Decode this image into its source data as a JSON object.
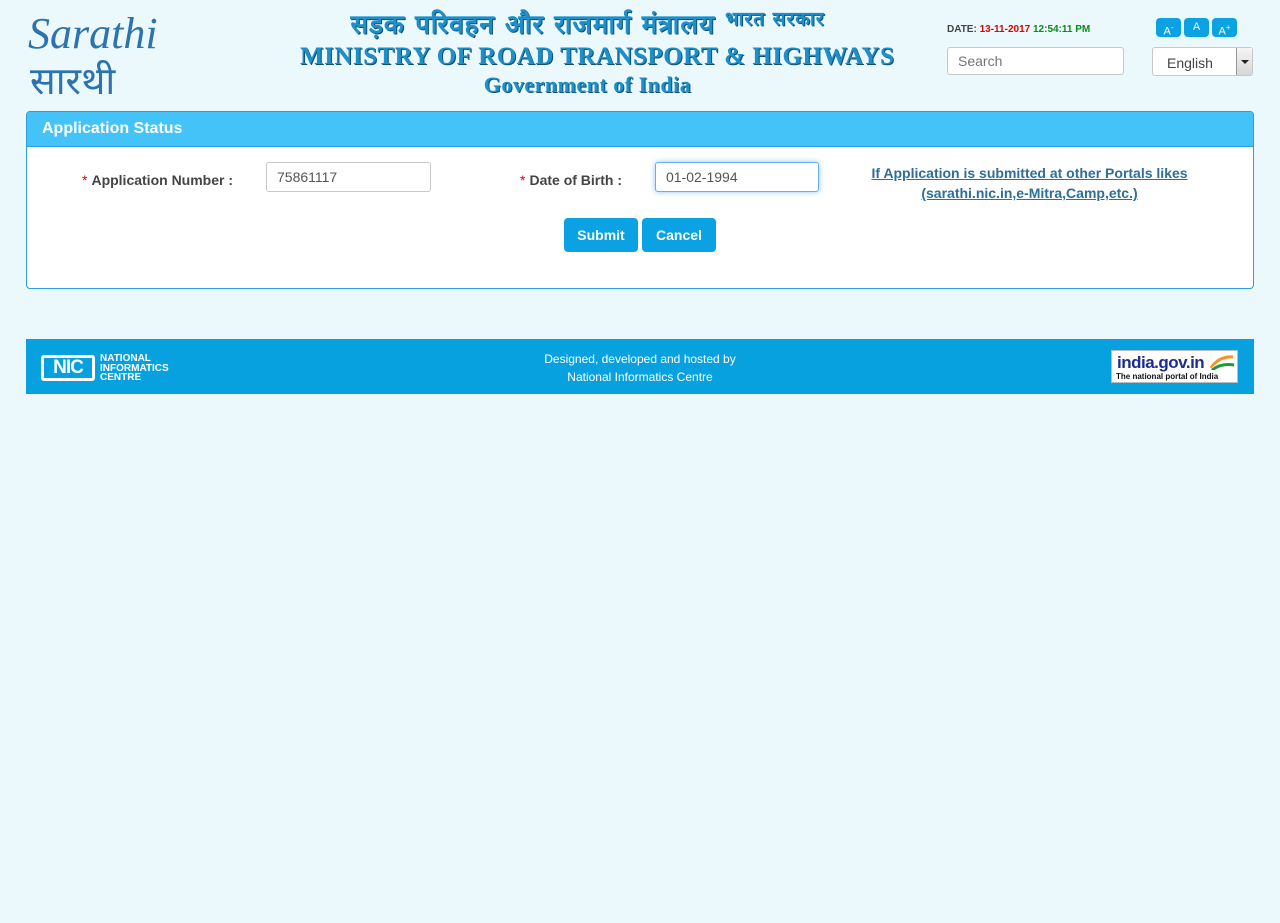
{
  "header": {
    "logo_text_en": "Sarathi",
    "logo_text_hi": "सारथी",
    "ministry_hindi": "सड़क परिवहन और राजमार्ग मंत्रालय",
    "ministry_hindi_small": "भारत सरकार",
    "ministry_english": "MINISTRY OF ROAD TRANSPORT & HIGHWAYS",
    "government": "Government of India",
    "date_label": "DATE:",
    "date_value": "13-11-2017",
    "time_value": "12:54:11 PM",
    "font_buttons": [
      "A",
      "A",
      "A"
    ],
    "font_button_sups": [
      "-",
      "",
      "+"
    ],
    "search_placeholder": "Search",
    "language": "English"
  },
  "panel": {
    "title": "Application Status",
    "required_marker": "*",
    "app_number_label": "Application Number :",
    "app_number_value": "75861117",
    "dob_label": "Date of Birth :",
    "dob_value": "01-02-1994",
    "other_portal_link_line1": "If Application is submitted at other Portals likes",
    "other_portal_link_line2": "(sarathi.nic.in,e-Mitra,Camp,etc.)",
    "submit_label": "Submit",
    "cancel_label": "Cancel"
  },
  "footer": {
    "nic_mark": "NIC",
    "nic_line1": "NATIONAL",
    "nic_line2": "INFORMATICS",
    "nic_line3": "CENTRE",
    "credit_line1": "Designed, developed and hosted by",
    "credit_line2": "National Informatics Centre",
    "india_portal": "india.gov.in",
    "india_portal_tagline": "The national portal of India"
  },
  "colors": {
    "accent": "#0aa2e3",
    "panel_header": "#43c3f7",
    "background": "#ebf8fc",
    "date": "#e00000",
    "time": "#0c8a1a"
  }
}
